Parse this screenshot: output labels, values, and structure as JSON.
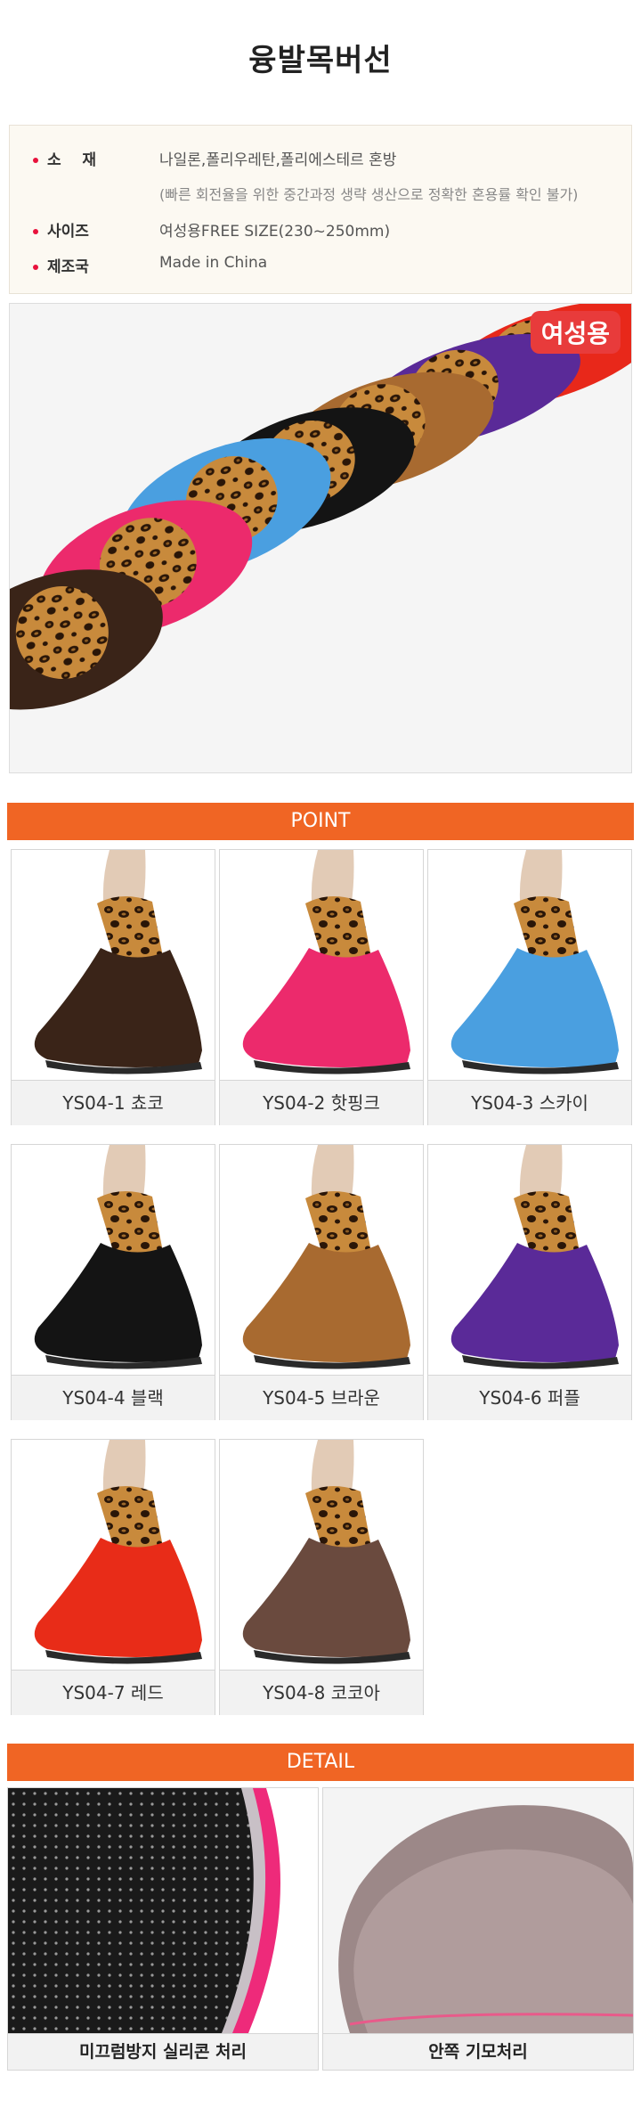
{
  "title": "융발목버선",
  "spec": {
    "material_label": "소    재",
    "material_value": "나일론,폴리우레탄,폴리에스테르 혼방",
    "material_note": "(빠른 회전율을 위한 중간과정 생략 생산으로 정확한 혼용률 확인 불가)",
    "size_label": "사이즈",
    "size_value": "여성용FREE SIZE(230~250mm)",
    "origin_label": "제조국",
    "origin_value": "Made in China"
  },
  "hero": {
    "badge": "여성용"
  },
  "point": {
    "header": "POINT",
    "items": [
      {
        "label": "YS04-1 쵸코",
        "color": "#3a2418"
      },
      {
        "label": "YS04-2 핫핑크",
        "color": "#ec2a6c"
      },
      {
        "label": "YS04-3 스카이",
        "color": "#4a9fe0"
      },
      {
        "label": "YS04-4 블랙",
        "color": "#141414"
      },
      {
        "label": "YS04-5 브라운",
        "color": "#a86a30"
      },
      {
        "label": "YS04-6 퍼플",
        "color": "#5a2a98"
      },
      {
        "label": "YS04-7 레드",
        "color": "#e82c18"
      },
      {
        "label": "YS04-8 코코아",
        "color": "#6a4a3e"
      }
    ]
  },
  "detail": {
    "header": "DETAIL",
    "items": [
      {
        "label": "미끄럼방지 실리콘 처리"
      },
      {
        "label": "안쪽 기모처리"
      }
    ]
  }
}
